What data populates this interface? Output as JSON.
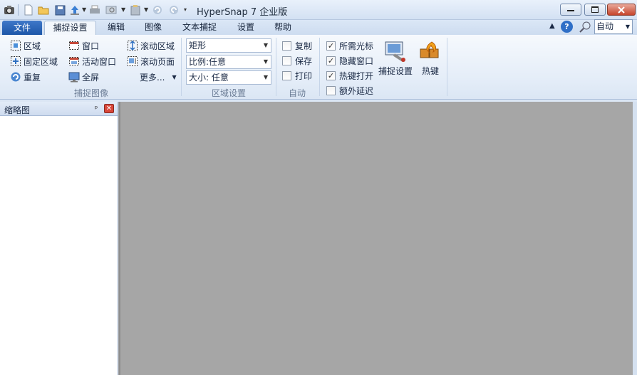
{
  "app_title": "HyperSnap 7 企业版",
  "quick_access_icons": [
    "camera-icon",
    "new-file-icon",
    "open-folder-icon",
    "save-icon",
    "upload-icon",
    "print-icon",
    "print-preview-icon",
    "paste-icon",
    "undo-icon",
    "redo-icon",
    "customize-icon"
  ],
  "ribbon_tabs": {
    "file": "文件",
    "tabs": [
      "捕捉设置",
      "编辑",
      "图像",
      "文本捕捉",
      "设置",
      "帮助"
    ],
    "active": "捕捉设置"
  },
  "view_mode": "自动",
  "capture_group": {
    "label": "捕捉图像",
    "col1": [
      "区域",
      "固定区域",
      "重复"
    ],
    "col2": [
      "窗口",
      "活动窗口",
      "全屏"
    ],
    "col3": [
      "滚动区域",
      "滚动页面",
      "更多..."
    ]
  },
  "region_settings": {
    "label": "区域设置",
    "shape": "矩形",
    "ratio": "比例:任意",
    "size": "大小: 任意"
  },
  "auto_group": {
    "label": "自动",
    "items": [
      {
        "label": "复制",
        "checked": false
      },
      {
        "label": "保存",
        "checked": false
      },
      {
        "label": "打印",
        "checked": false
      }
    ]
  },
  "options_group": {
    "items": [
      {
        "label": "所需光标",
        "checked": true
      },
      {
        "label": "隐藏窗口",
        "checked": true
      },
      {
        "label": "热键打开",
        "checked": true
      },
      {
        "label": "额外延迟",
        "checked": false
      }
    ]
  },
  "big_buttons": {
    "capture_settings": "捕捉设置",
    "hotkeys": "热键"
  },
  "thumbnail_pane": {
    "title": "缩略图",
    "pin": "ᵖ"
  }
}
